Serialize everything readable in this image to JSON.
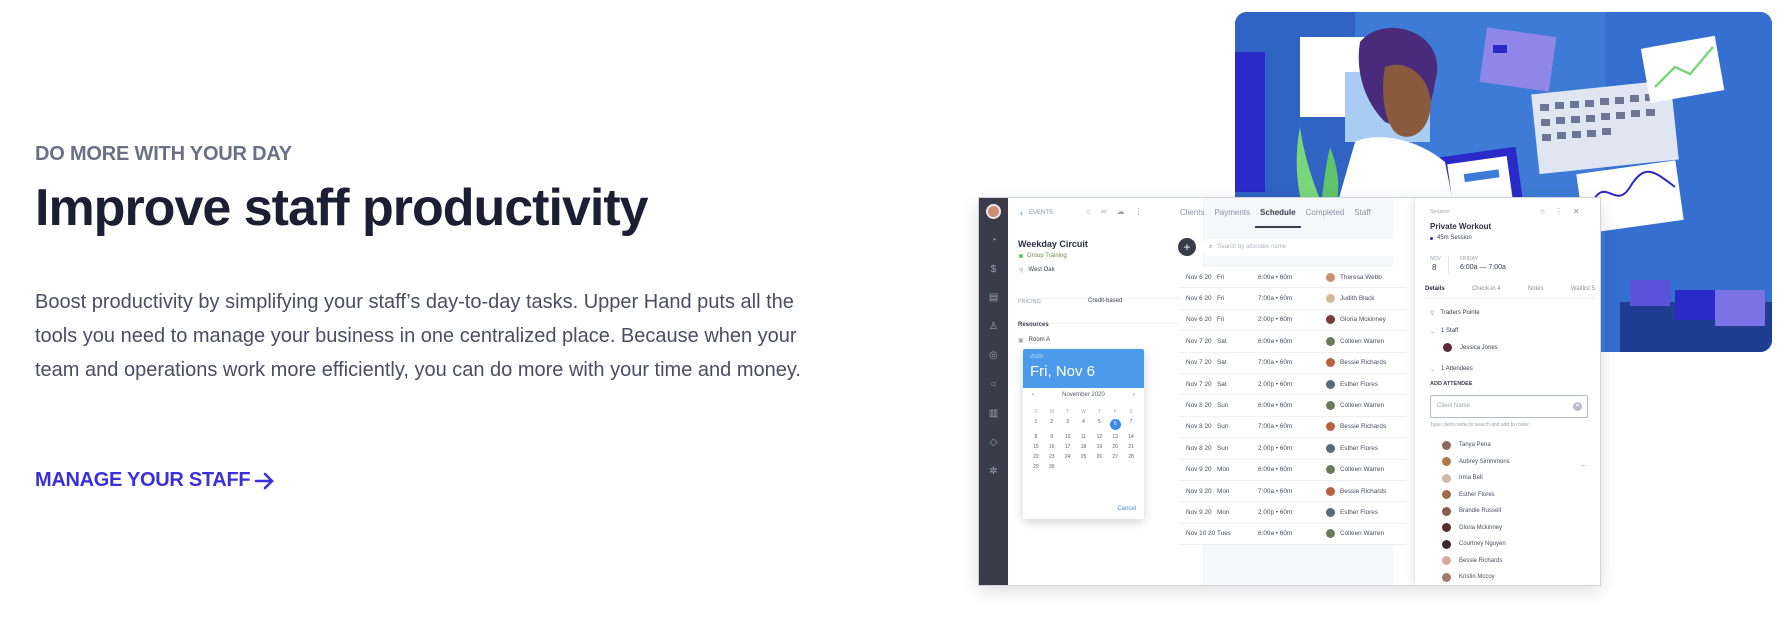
{
  "hero": {
    "eyebrow": "DO MORE WITH YOUR DAY",
    "headline": "Improve staff productivity",
    "body": "Boost productivity by simplifying your staff’s day-to-day tasks. Upper Hand puts all the tools you need to manage your business in one centralized place. Because when your team and operations work more efficiently, you can do more with your time and money.",
    "cta_label": "MANAGE YOUR STAFF"
  },
  "app": {
    "breadcrumb": "EVENTS",
    "event_title": "Weekday Circuit",
    "event_type": "Group Training",
    "location": "West Oak",
    "pricing_label": "PRICING",
    "pricing_value": "Credit-based",
    "resources_label": "Resources",
    "resource_item": "Room A",
    "tabs": [
      "Clients",
      "Payments",
      "Schedule",
      "Completed",
      "Staff"
    ],
    "search_placeholder": "Search by attendee name",
    "schedule": [
      {
        "date": "Nov 6 20",
        "day": "Fri",
        "time": "6:00a • 60m",
        "staff": "Theresa Webb"
      },
      {
        "date": "Nov 6 20",
        "day": "Fri",
        "time": "7:00a • 60m",
        "staff": "Judith Black"
      },
      {
        "date": "Nov 6 20",
        "day": "Fri",
        "time": "2:00p • 60m",
        "staff": "Gloria Mckinney"
      },
      {
        "date": "Nov 7 20",
        "day": "Sat",
        "time": "6:00a • 60m",
        "staff": "Colleen Warren"
      },
      {
        "date": "Nov 7 20",
        "day": "Sat",
        "time": "7:00a • 60m",
        "staff": "Bessie Richards"
      },
      {
        "date": "Nov 7 20",
        "day": "Sat",
        "time": "2:00p • 60m",
        "staff": "Esther Flores"
      },
      {
        "date": "Nov 8 20",
        "day": "Sun",
        "time": "6:00a • 60m",
        "staff": "Colleen Warren"
      },
      {
        "date": "Nov 8 20",
        "day": "Sun",
        "time": "7:00a • 60m",
        "staff": "Bessie Richards"
      },
      {
        "date": "Nov 8 20",
        "day": "Sun",
        "time": "2:00p • 60m",
        "staff": "Esther Flores"
      },
      {
        "date": "Nov 9 20",
        "day": "Mon",
        "time": "6:00a • 60m",
        "staff": "Colleen Warren"
      },
      {
        "date": "Nov 9 20",
        "day": "Mon",
        "time": "7:00a • 60m",
        "staff": "Bessie Richards"
      },
      {
        "date": "Nov 9 20",
        "day": "Mon",
        "time": "2:00p • 60m",
        "staff": "Esther Flores"
      },
      {
        "date": "Nov 10 20",
        "day": "Tues",
        "time": "6:00a • 60m",
        "staff": "Colleen Warren"
      }
    ],
    "calendar": {
      "year": "2020",
      "date_display": "Fri, Nov 6",
      "month": "November 2020",
      "weekdays": [
        "S",
        "M",
        "T",
        "W",
        "T",
        "F",
        "S"
      ],
      "days": [
        "1",
        "2",
        "3",
        "4",
        "5",
        "6",
        "7",
        "8",
        "9",
        "10",
        "11",
        "12",
        "13",
        "14",
        "15",
        "16",
        "17",
        "18",
        "19",
        "20",
        "21",
        "22",
        "23",
        "24",
        "25",
        "26",
        "27",
        "28",
        "29",
        "30"
      ],
      "selected_day": "6",
      "cancel_label": "Cancel"
    },
    "session": {
      "label": "Session",
      "title": "Private Workout",
      "duration": "45m Session",
      "month": "NOV",
      "day_num": "8",
      "weekday": "FRIDAY",
      "time_range": "6:00a — 7:00a",
      "tabs": [
        "Details",
        "Check-in 4",
        "Notes",
        "Waitlist 5"
      ],
      "location": "Traders Pointe",
      "staff_count": "1 Staff",
      "staff_member": "Jessica Jones",
      "attendees_count": "1 Attendees",
      "add_attendee_label": "ADD ATTENDEE",
      "client_placeholder": "Client Name",
      "helper_text": "Type client name to search and add to roster.",
      "clients": [
        "Tanya Pena",
        "Aubrey Simmmons",
        "Irma Bell",
        "Esther Flores",
        "Brandie Russell",
        "Gloria Mckinney",
        "Courtney Nguyen",
        "Bessie Richards",
        "Kristin Mccoy"
      ]
    }
  },
  "colors": {
    "accent": "#3b2fd9",
    "headline": "#1c1f33",
    "eyebrow": "#6b7086",
    "illustration_bg": "#3d7bd6",
    "calendar_header": "#4b9bea"
  }
}
